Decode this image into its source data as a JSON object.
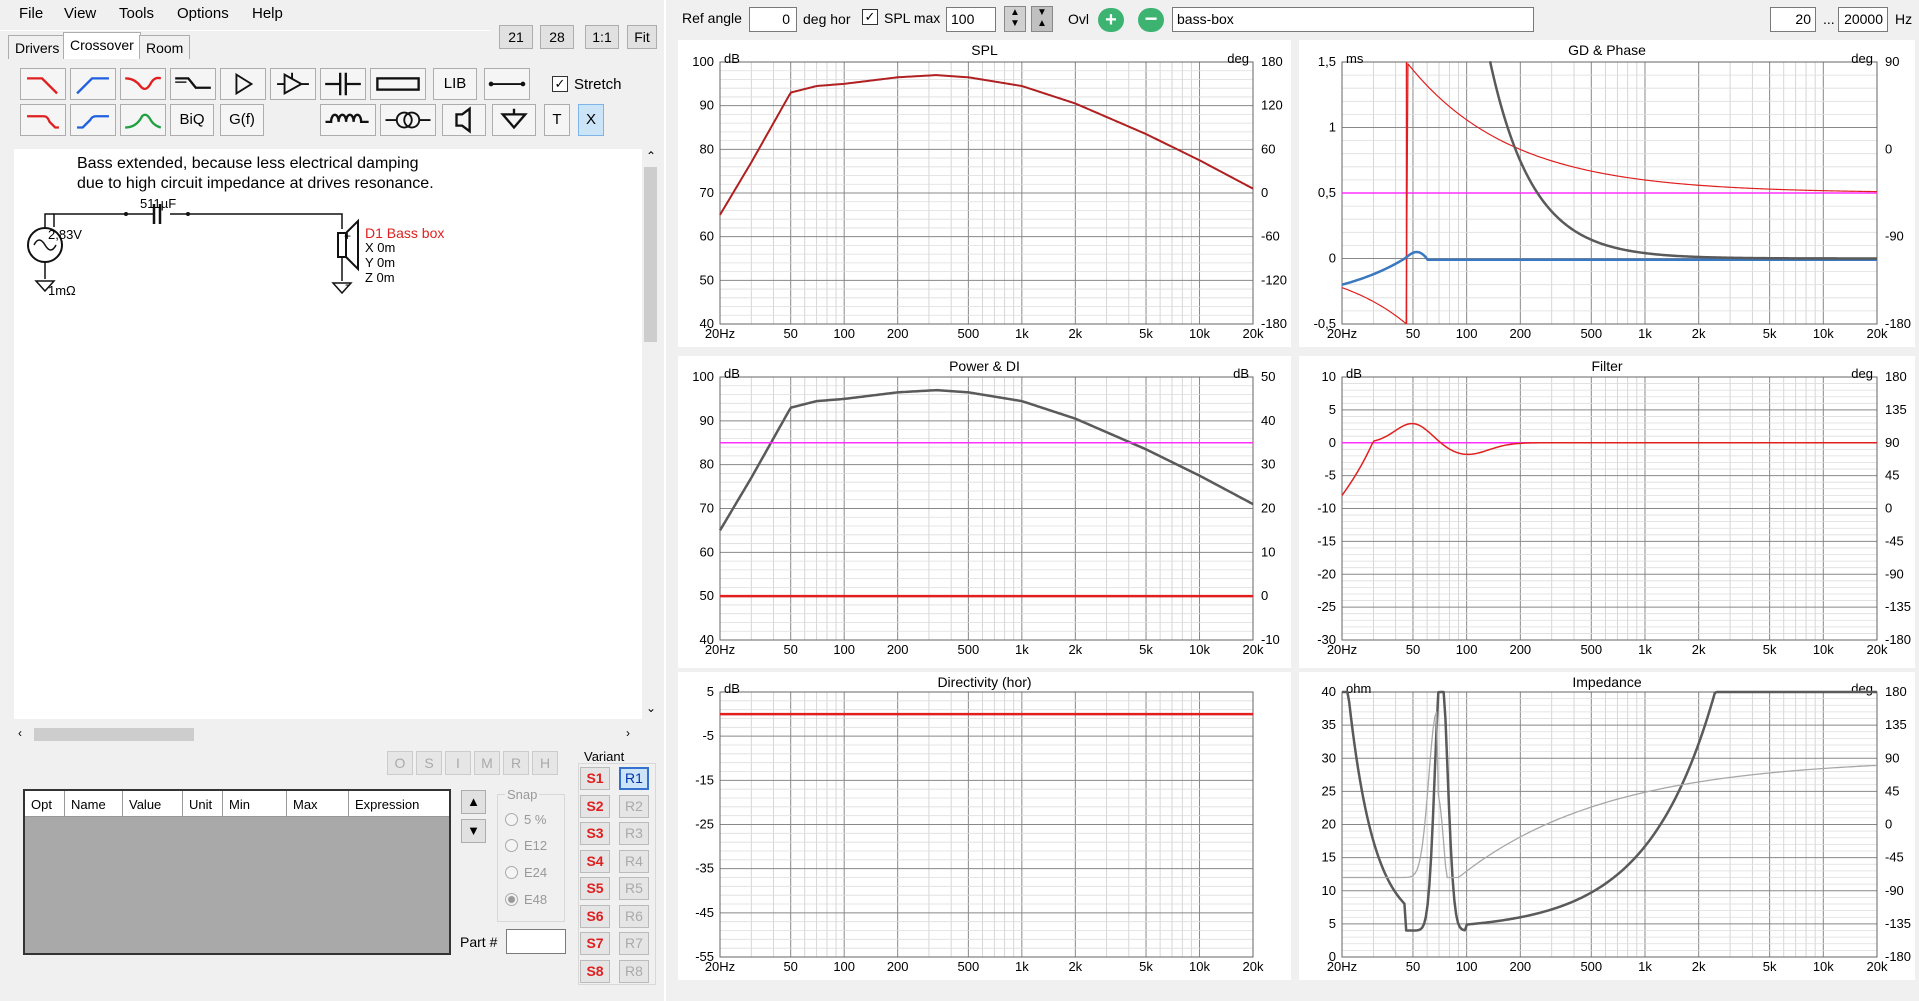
{
  "menu": [
    "File",
    "View",
    "Tools",
    "Options",
    "Help"
  ],
  "tabs": [
    "Drivers",
    "Crossover",
    "Room"
  ],
  "zoom_buttons": [
    "21",
    "28",
    "1:1",
    "Fit"
  ],
  "tools": {
    "lib": "LIB",
    "biq": "BiQ",
    "gf": "G(f)",
    "t": "T",
    "x": "X",
    "stretch": "Stretch"
  },
  "schematic": {
    "note1": "Bass extended, because less electrical damping",
    "note2": "due to high circuit impedance at drives resonance.",
    "cap": "511µF",
    "voltage": "2,83V",
    "rs": "1mΩ",
    "driver": "D1 Bass box",
    "x": "X 0m",
    "y": "Y 0m",
    "z": "Z 0m",
    "plus": "+",
    "minus": "-"
  },
  "opt_buttons": [
    "O",
    "S",
    "I",
    "M",
    "R",
    "H"
  ],
  "table_headers": [
    "Opt",
    "Name",
    "Value",
    "Unit",
    "Min",
    "Max",
    "Expression"
  ],
  "snap": {
    "label": "Snap",
    "options": [
      "5 %",
      "E12",
      "E24",
      "E48"
    ]
  },
  "part_label": "Part #",
  "variant": {
    "label": "Variant",
    "s": [
      "S1",
      "S2",
      "S3",
      "S4",
      "S5",
      "S6",
      "S7",
      "S8"
    ],
    "r": [
      "R1",
      "R2",
      "R3",
      "R4",
      "R5",
      "R6",
      "R7",
      "R8"
    ]
  },
  "top": {
    "ref_angle_label": "Ref angle",
    "ref_angle": "0",
    "deg_hor": "deg hor",
    "spl_max_label": "SPL max",
    "spl_max": "100",
    "ovl": "Ovl",
    "name": "bass-box",
    "f_min": "20",
    "dots": "...",
    "f_max": "20000",
    "hz": "Hz"
  },
  "freq_ticks": [
    "20Hz",
    "50",
    "100",
    "200",
    "500",
    "1k",
    "2k",
    "5k",
    "10k",
    "20k"
  ],
  "colors": {
    "red": "#e02020",
    "darkred": "#b02020",
    "grey": "#5a5a5a",
    "magenta": "#ff30ff",
    "blue": "#3a78c0",
    "lightgrey": "#a8a8a8",
    "accent": "#3cb371"
  },
  "chart_data": [
    {
      "type": "line",
      "title": "SPL",
      "ylabel": "dB",
      "y2label": "deg",
      "ylim": [
        40,
        100
      ],
      "y2lim": [
        -180,
        180
      ],
      "yticks": [
        "100",
        "90",
        "80",
        "70",
        "60",
        "50",
        "40"
      ],
      "y2ticks": [
        "180",
        "120",
        "60",
        "0",
        "-60",
        "-120",
        "-180"
      ],
      "series": [
        {
          "x": [
            20,
            30,
            50,
            70,
            100,
            200,
            330,
            500,
            1000,
            2000,
            5000,
            10000,
            20000
          ],
          "values": [
            65,
            77,
            93,
            94.5,
            95,
            96.5,
            97,
            96.5,
            94.5,
            90.5,
            83.5,
            77.5,
            71
          ]
        }
      ]
    },
    {
      "type": "line",
      "title": "GD & Phase",
      "ylabel": "ms",
      "y2label": "deg",
      "ylim": [
        -0.5,
        1.5
      ],
      "y2lim": [
        -180,
        180
      ],
      "yticks": [
        "1,5",
        "1",
        "0,5",
        "0",
        "-0,5"
      ],
      "y2ticks": [
        "90",
        "0",
        "-90",
        "-180"
      ],
      "series": []
    },
    {
      "type": "line",
      "title": "Power & DI",
      "ylabel": "dB",
      "y2label": "dB",
      "ylim": [
        40,
        100
      ],
      "y2lim": [
        -10,
        50
      ],
      "yticks": [
        "100",
        "90",
        "80",
        "70",
        "60",
        "50",
        "40"
      ],
      "y2ticks": [
        "50",
        "40",
        "30",
        "20",
        "10",
        "0",
        "-10"
      ],
      "series": [
        {
          "x": [
            20,
            30,
            50,
            70,
            100,
            200,
            330,
            500,
            1000,
            2000,
            5000,
            10000,
            20000
          ],
          "values": [
            65,
            77,
            93,
            94.5,
            95,
            96.5,
            97,
            96.5,
            94.5,
            90.5,
            83.5,
            77.5,
            71
          ]
        }
      ]
    },
    {
      "type": "line",
      "title": "Filter",
      "ylabel": "dB",
      "y2label": "deg",
      "ylim": [
        -30,
        10
      ],
      "y2lim": [
        -180,
        180
      ],
      "yticks": [
        "10",
        "5",
        "0",
        "-5",
        "-10",
        "-15",
        "-20",
        "-25",
        "-30"
      ],
      "y2ticks": [
        "180",
        "135",
        "90",
        "45",
        "0",
        "-45",
        "-90",
        "-135",
        "-180"
      ],
      "series": []
    },
    {
      "type": "line",
      "title": "Directivity (hor)",
      "ylabel": "dB",
      "ylim": [
        -55,
        5
      ],
      "yticks": [
        "5",
        "-5",
        "-15",
        "-25",
        "-35",
        "-45",
        "-55"
      ],
      "series": [
        {
          "x": [
            20,
            20000
          ],
          "values": [
            0,
            0
          ]
        }
      ]
    },
    {
      "type": "line",
      "title": "Impedance",
      "ylabel": "ohm",
      "y2label": "deg",
      "ylim": [
        0,
        40
      ],
      "y2lim": [
        -180,
        180
      ],
      "yticks": [
        "40",
        "35",
        "30",
        "25",
        "20",
        "15",
        "10",
        "5",
        "0"
      ],
      "y2ticks": [
        "180",
        "135",
        "90",
        "45",
        "0",
        "-45",
        "-90",
        "-135",
        "-180"
      ],
      "series": []
    }
  ]
}
